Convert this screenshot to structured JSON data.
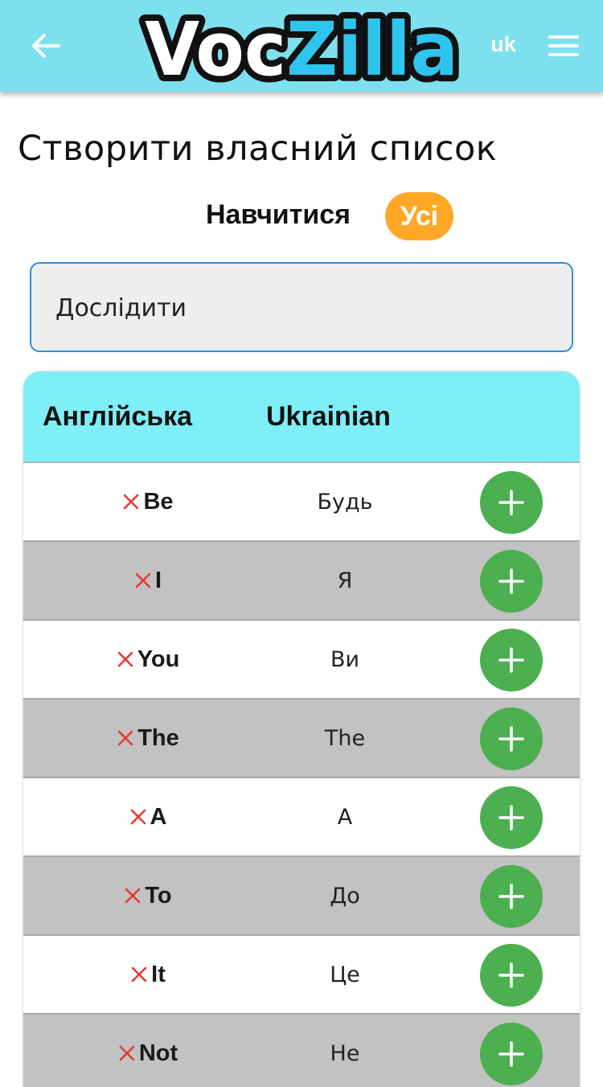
{
  "header": {
    "logo_text": "VocZilla",
    "language": "uk"
  },
  "page": {
    "title": "Створити власний список",
    "learn_label": "Навчитися",
    "filter_pill": "Усі"
  },
  "search": {
    "placeholder": "Дослідити"
  },
  "table": {
    "columns": [
      "Англійська",
      "Ukrainian"
    ],
    "rows": [
      {
        "en": "Be",
        "uk": "Будь"
      },
      {
        "en": "I",
        "uk": "Я"
      },
      {
        "en": "You",
        "uk": "Ви"
      },
      {
        "en": "The",
        "uk": "The"
      },
      {
        "en": "A",
        "uk": "A"
      },
      {
        "en": "To",
        "uk": "До"
      },
      {
        "en": "It",
        "uk": "Це"
      },
      {
        "en": "Not",
        "uk": "Не"
      }
    ]
  },
  "colors": {
    "header_bg": "#7de0ef",
    "table_header_bg": "#7eeef7",
    "pill_bg": "#ffa726",
    "add_button": "#4caf50",
    "remove_icon": "#e53935",
    "search_border": "#2d8fe0",
    "row_alt_bg": "#c2c2c2"
  },
  "icons": {
    "back": "arrow-left-icon",
    "menu": "hamburger-menu-icon",
    "remove": "close-x-icon",
    "add": "plus-icon"
  }
}
